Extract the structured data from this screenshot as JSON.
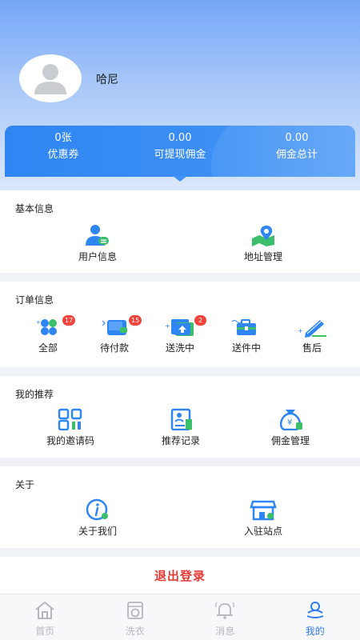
{
  "profile": {
    "username": "哈尼"
  },
  "stats": [
    {
      "value": "0张",
      "label": "优惠券"
    },
    {
      "value": "0.00",
      "label": "可提现佣金"
    },
    {
      "value": "0.00",
      "label": "佣金总计"
    }
  ],
  "basic": {
    "title": "基本信息",
    "items": [
      {
        "label": "用户信息",
        "icon": "user-info-icon"
      },
      {
        "label": "地址管理",
        "icon": "map-pin-icon"
      }
    ]
  },
  "orders": {
    "title": "订单信息",
    "items": [
      {
        "label": "全部",
        "icon": "grid-icon",
        "badge": "17"
      },
      {
        "label": "待付款",
        "icon": "wallet-icon",
        "badge": "15"
      },
      {
        "label": "送洗中",
        "icon": "folder-upload-icon",
        "badge": "2"
      },
      {
        "label": "送件中",
        "icon": "briefcase-icon",
        "badge": ""
      },
      {
        "label": "售后",
        "icon": "pencil-icon",
        "badge": ""
      }
    ]
  },
  "recommend": {
    "title": "我的推荐",
    "items": [
      {
        "label": "我的邀请码",
        "icon": "qrcode-icon"
      },
      {
        "label": "推荐记录",
        "icon": "record-icon"
      },
      {
        "label": "佣金管理",
        "icon": "money-bag-icon"
      }
    ]
  },
  "about": {
    "title": "关于",
    "items": [
      {
        "label": "关于我们",
        "icon": "info-icon"
      },
      {
        "label": "入驻站点",
        "icon": "store-icon"
      }
    ]
  },
  "logout_label": "退出登录",
  "tabs": [
    {
      "label": "首页",
      "icon": "home-icon",
      "active": false
    },
    {
      "label": "洗衣",
      "icon": "washer-icon",
      "active": false
    },
    {
      "label": "消息",
      "icon": "bell-icon",
      "active": false
    },
    {
      "label": "我的",
      "icon": "profile-icon",
      "active": true
    }
  ],
  "colors": {
    "primary": "#2f85f2",
    "accent_green": "#3bbf6a",
    "danger": "#e53935",
    "inactive": "#b4b8be"
  }
}
